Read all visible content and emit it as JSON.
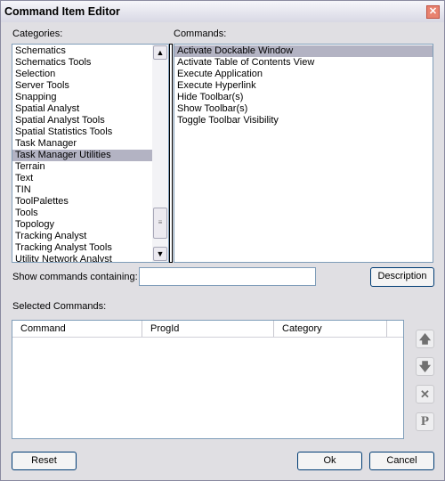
{
  "window": {
    "title": "Command Item Editor"
  },
  "categories": {
    "label": "Categories:",
    "items": [
      "Schematics",
      "Schematics Tools",
      "Selection",
      "Server Tools",
      "Snapping",
      "Spatial Analyst",
      "Spatial Analyst Tools",
      "Spatial Statistics Tools",
      "Task Manager",
      "Task Manager Utilities",
      "Terrain",
      "Text",
      "TIN",
      "ToolPalettes",
      "Tools",
      "Topology",
      "Tracking Analyst",
      "Tracking Analyst Tools",
      "Utility Network Analyst"
    ],
    "selected": "Task Manager Utilities"
  },
  "commands": {
    "label": "Commands:",
    "items": [
      "Activate Dockable Window",
      "Activate Table of Contents View",
      "Execute Application",
      "Execute Hyperlink",
      "Hide Toolbar(s)",
      "Show Toolbar(s)",
      "Toggle Toolbar Visibility"
    ],
    "selected": "Activate Dockable Window"
  },
  "filter": {
    "label": "Show commands containing:",
    "value": ""
  },
  "description_button": "Description",
  "selected_commands": {
    "label": "Selected Commands:",
    "columns": [
      "Command",
      "ProgId",
      "Category"
    ]
  },
  "buttons": {
    "reset": "Reset",
    "ok": "Ok",
    "cancel": "Cancel"
  }
}
